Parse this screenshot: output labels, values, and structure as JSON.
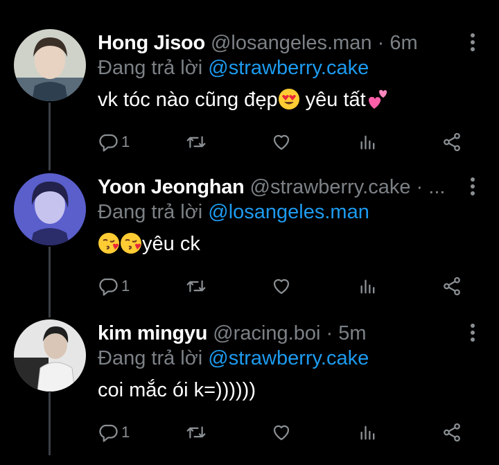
{
  "colors": {
    "background": "#000000",
    "accent": "#1d9bf0",
    "muted": "#7c8186",
    "text": "#ffffff"
  },
  "reply_prefix": "Đang trả lời",
  "tweets": [
    {
      "name": "Hong Jisoo",
      "handle": "@losangeles.man",
      "separator": "·",
      "time": "6m",
      "reply_to": "@strawberry.cake",
      "text_parts": [
        "vk tóc nào cũng đẹp",
        " yêu tất"
      ],
      "emojis": [
        "heart-eyes-emoji",
        "two-hearts-emoji"
      ],
      "replies": "1"
    },
    {
      "name": "Yoon Jeonghan",
      "handle": "@strawberry.cake",
      "separator": "·",
      "time": "...",
      "reply_to": "@losangeles.man",
      "text_parts": [
        "",
        "yêu ck"
      ],
      "emojis": [
        "kissing-heart-emoji",
        "kissing-heart-emoji"
      ],
      "replies": "1"
    },
    {
      "name": "kim mingyu",
      "handle": "@racing.boi",
      "separator": "·",
      "time": "5m",
      "reply_to": "@strawberry.cake",
      "text_parts": [
        "coi mắc ói k=))))))"
      ],
      "emojis": [],
      "replies": "1"
    }
  ],
  "icons": [
    "reply-icon",
    "retweet-icon",
    "like-icon",
    "analytics-icon",
    "share-icon",
    "more-options-icon"
  ]
}
